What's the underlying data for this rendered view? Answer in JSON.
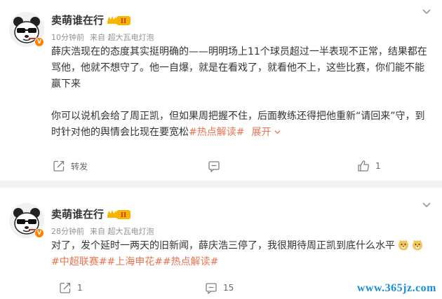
{
  "posts": [
    {
      "username": "卖萌谁在行",
      "time": "10分钟前",
      "source": "来自 超大瓦电灯泡",
      "para1": "薛庆浩现在的态度其实挺明确的——明明场上11个球员超过一半表现不正常，结果都在骂他，他就不想守了。他一自爆，就是在看戏了，就看他不上，这些比赛，你们能不能赢下来",
      "para2_text": "你可以说机会给了周正凯，但如果周把握不住，后面教练还得把他重新“请回来”守，到时针对他的舆情会比现在要宽松",
      "hashtag": "#热点解读#",
      "expand": "展开",
      "repost_label": "转发",
      "comment_count": "",
      "like_count": "1"
    },
    {
      "username": "卖萌谁在行",
      "time": "28分钟前",
      "source": "来自 超大瓦电灯泡",
      "text": "对了，发个延时一两天的旧新闻，薛庆浩三停了，我很期待周正凯到底什么水平",
      "hashtags": "#中超联赛##上海申花##热点解读#",
      "repost_count": "1",
      "comment_count": "15"
    }
  ],
  "level_badge": "II",
  "watermark": "www.365jz.com",
  "icons": [
    "avatar",
    "verified-badge",
    "level-badge",
    "chevron-down-icon",
    "repost-icon",
    "comment-icon",
    "like-icon",
    "doge-emoji"
  ],
  "colors": {
    "link": "#eb7350",
    "meta": "#939393",
    "badge": "#ff8200",
    "watermark": "#1a8fd6"
  }
}
